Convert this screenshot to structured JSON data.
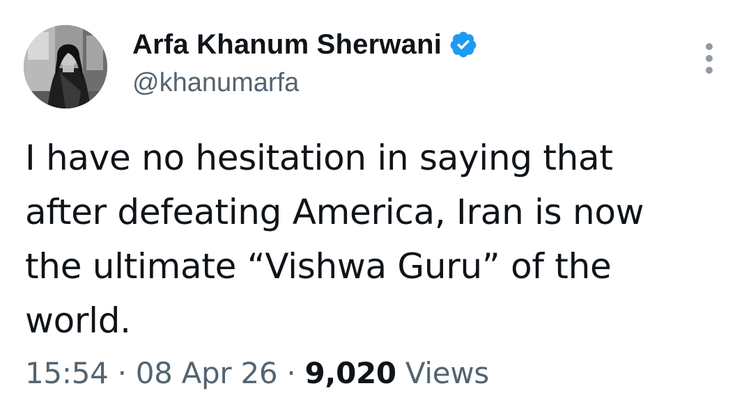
{
  "author": {
    "display_name": "Arfa Khanum Sherwani",
    "handle": "@khanumarfa",
    "verified_color": "#1d9bf0"
  },
  "tweet": {
    "lines": [
      "I have no hesitation in saying that",
      "after defeating America, Iran is now",
      "the ultimate “Vishwa Guru” of the",
      "world."
    ]
  },
  "meta": {
    "time": "15:54",
    "separator": "·",
    "date": "08 Apr 26",
    "views_count": "9,020",
    "views_label": "Views"
  },
  "icons": {
    "more": "more-options-icon",
    "verified": "verified-badge-icon"
  }
}
